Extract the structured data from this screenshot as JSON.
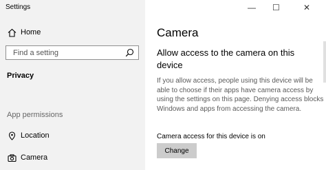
{
  "window": {
    "title": "Settings",
    "controls": [
      "—",
      "☐",
      "✕"
    ]
  },
  "sidebar": {
    "home_label": "Home",
    "search_placeholder": "Find a setting",
    "section_heading": "Privacy",
    "subheading": "App permissions",
    "items": [
      {
        "label": "Location",
        "icon": "location-icon"
      },
      {
        "label": "Camera",
        "icon": "camera-icon"
      }
    ]
  },
  "main": {
    "title": "Camera",
    "section_title": "Allow access to the camera on this device",
    "description": "If you allow access, people using this device will be able to choose if their apps have camera access by using the settings on this page. Denying access blocks Windows and apps from accessing the camera.",
    "status_text": "Camera access for this device is on",
    "change_button": "Change"
  }
}
